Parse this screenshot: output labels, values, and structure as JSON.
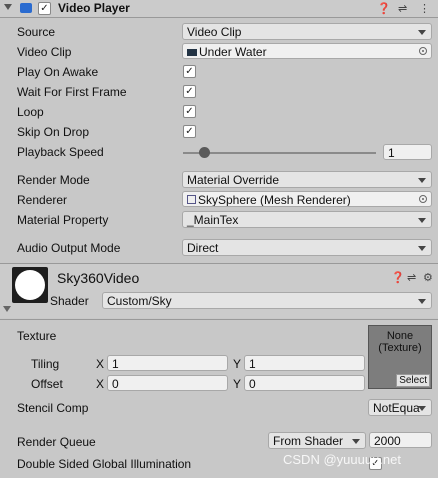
{
  "video_player": {
    "title": "Video Player",
    "rows": {
      "source": {
        "label": "Source",
        "value": "Video Clip"
      },
      "video_clip": {
        "label": "Video Clip",
        "value": "Under Water"
      },
      "play_on_awake": {
        "label": "Play On Awake",
        "checked": true
      },
      "wait_first_frame": {
        "label": "Wait For First Frame",
        "checked": true
      },
      "loop": {
        "label": "Loop",
        "checked": true
      },
      "skip_on_drop": {
        "label": "Skip On Drop",
        "checked": true
      },
      "playback_speed": {
        "label": "Playback Speed",
        "value": "1",
        "slider_fraction": 0.08
      },
      "render_mode": {
        "label": "Render Mode",
        "value": "Material Override"
      },
      "renderer": {
        "label": "Renderer",
        "value": "SkySphere (Mesh Renderer)"
      },
      "material_property": {
        "label": "Material Property",
        "value": "_MainTex"
      },
      "audio_output_mode": {
        "label": "Audio Output Mode",
        "value": "Direct"
      }
    }
  },
  "material": {
    "name": "Sky360Video",
    "shader_label": "Shader",
    "shader_value": "Custom/Sky",
    "texture_label": "Texture",
    "texture_slot": {
      "line1": "None",
      "line2": "(Texture)",
      "select": "Select"
    },
    "tiling": {
      "label": "Tiling",
      "x_label": "X",
      "x": "1",
      "y_label": "Y",
      "y": "1"
    },
    "offset": {
      "label": "Offset",
      "x_label": "X",
      "x": "0",
      "y_label": "Y",
      "y": "0"
    },
    "stencil": {
      "label": "Stencil Comp",
      "value": "NotEqua"
    },
    "render_queue": {
      "label": "Render Queue",
      "mode": "From Shader",
      "value": "2000"
    },
    "double_sided_gi": {
      "label": "Double Sided Global Illumination",
      "checked": true
    }
  },
  "watermark": "CSDN @yuuuuu.net",
  "colors": {
    "accent": "#2a6bd0",
    "background": "#c8c8c8"
  },
  "icons": [
    "help-icon",
    "presets-icon",
    "more-icon",
    "settings-icon"
  ]
}
